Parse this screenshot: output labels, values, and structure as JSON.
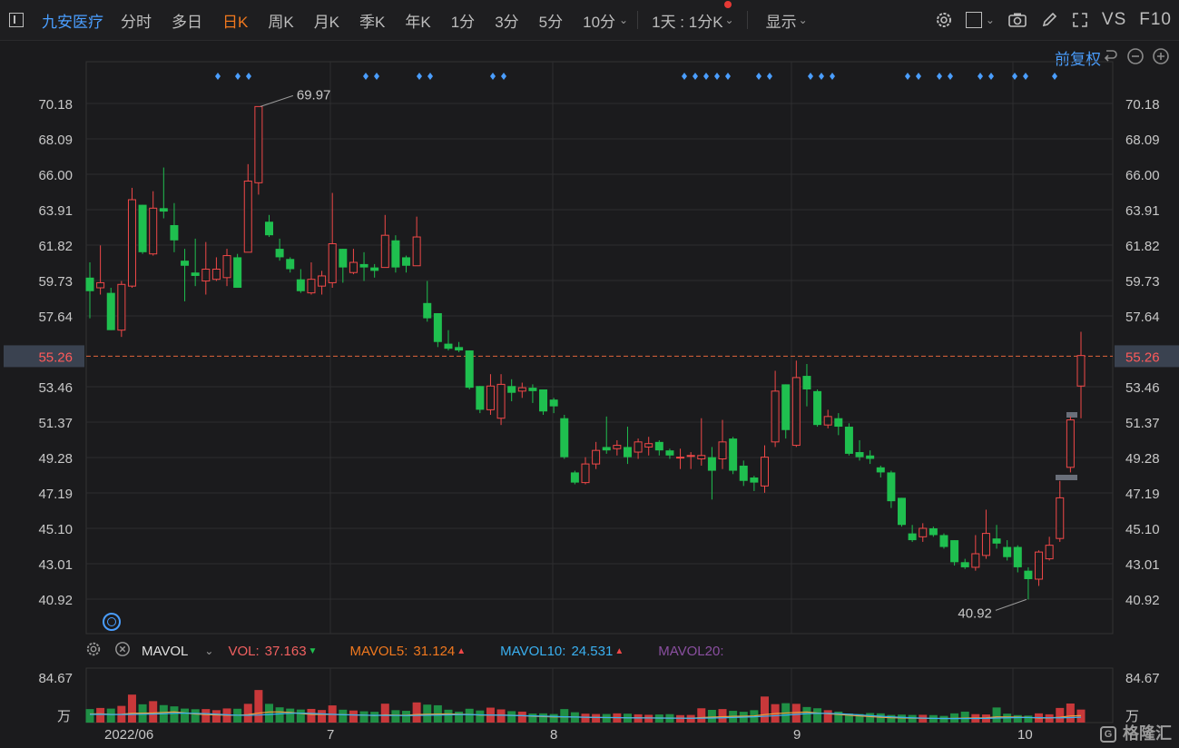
{
  "toolbar": {
    "stock_name": "九安医疗",
    "periods": [
      "分时",
      "多日",
      "日K",
      "周K",
      "月K",
      "季K",
      "年K",
      "1分",
      "3分",
      "5分",
      "10分"
    ],
    "active_period": "日K",
    "interval_label": "1天 : 1分K",
    "display_label": "显示",
    "vs_label": "VS",
    "f10_label": "F10"
  },
  "chart_header": {
    "adjust_label": "前复权"
  },
  "price_axis": {
    "ticks": [
      "70.18",
      "68.09",
      "66.00",
      "63.91",
      "61.82",
      "59.73",
      "57.64",
      "55.26",
      "53.46",
      "51.37",
      "49.28",
      "47.19",
      "45.10",
      "43.01",
      "40.92"
    ],
    "current_price": "55.26"
  },
  "annotations": {
    "high": "69.97",
    "low": "40.92"
  },
  "volume_header": {
    "indicator": "MAVOL",
    "vol_label": "VOL:",
    "vol_value": "37.163",
    "mavol5_label": "MAVOL5:",
    "mavol5_value": "31.124",
    "mavol10_label": "MAVOL10:",
    "mavol10_value": "24.531",
    "mavol20_label": "MAVOL20:"
  },
  "volume_axis": {
    "top": "84.67",
    "unit": "万"
  },
  "date_axis": {
    "labels": [
      "2022/06",
      "7",
      "8",
      "9",
      "10"
    ]
  },
  "brand": "格隆汇",
  "colors": {
    "up": "#f04848",
    "down": "#1fbf4f",
    "accent": "#f0781e",
    "link": "#4a9eff"
  },
  "chart_data": {
    "type": "candlestick",
    "ylim": [
      40.0,
      71.0
    ],
    "candles": [
      {
        "o": 59.9,
        "c": 59.1,
        "h": 60.8,
        "l": 57.5
      },
      {
        "o": 59.3,
        "c": 59.6,
        "h": 61.8,
        "l": 58.9
      },
      {
        "o": 59.0,
        "c": 56.8,
        "h": 59.3,
        "l": 56.8
      },
      {
        "o": 56.8,
        "c": 59.5,
        "h": 59.7,
        "l": 56.4
      },
      {
        "o": 59.4,
        "c": 64.5,
        "h": 65.2,
        "l": 59.3
      },
      {
        "o": 64.2,
        "c": 61.4,
        "h": 64.2,
        "l": 61.3
      },
      {
        "o": 61.3,
        "c": 64.0,
        "h": 65.0,
        "l": 61.2
      },
      {
        "o": 64.0,
        "c": 63.8,
        "h": 66.4,
        "l": 63.4
      },
      {
        "o": 63.0,
        "c": 62.1,
        "h": 64.3,
        "l": 61.4
      },
      {
        "o": 60.9,
        "c": 60.6,
        "h": 61.6,
        "l": 58.5
      },
      {
        "o": 60.2,
        "c": 60.0,
        "h": 62.2,
        "l": 59.4
      },
      {
        "o": 59.7,
        "c": 60.4,
        "h": 62.0,
        "l": 58.9
      },
      {
        "o": 59.8,
        "c": 60.4,
        "h": 61.1,
        "l": 59.7
      },
      {
        "o": 59.9,
        "c": 61.2,
        "h": 61.6,
        "l": 59.4
      },
      {
        "o": 61.1,
        "c": 59.3,
        "h": 61.3,
        "l": 59.3
      },
      {
        "o": 61.4,
        "c": 65.6,
        "h": 66.6,
        "l": 62.3
      },
      {
        "o": 65.5,
        "c": 70.0,
        "h": 70.0,
        "l": 64.8
      },
      {
        "o": 63.2,
        "c": 62.4,
        "h": 63.6,
        "l": 62.3
      },
      {
        "o": 61.6,
        "c": 61.1,
        "h": 62.2,
        "l": 60.9
      },
      {
        "o": 61.0,
        "c": 60.4,
        "h": 61.1,
        "l": 60.2
      },
      {
        "o": 59.8,
        "c": 59.1,
        "h": 60.4,
        "l": 59.0
      },
      {
        "o": 59.0,
        "c": 59.8,
        "h": 60.8,
        "l": 58.9
      },
      {
        "o": 59.4,
        "c": 60.0,
        "h": 60.3,
        "l": 58.9
      },
      {
        "o": 59.6,
        "c": 61.9,
        "h": 64.9,
        "l": 59.3
      },
      {
        "o": 61.6,
        "c": 60.5,
        "h": 61.6,
        "l": 59.6
      },
      {
        "o": 60.2,
        "c": 60.8,
        "h": 61.6,
        "l": 60.1
      },
      {
        "o": 60.7,
        "c": 60.5,
        "h": 61.4,
        "l": 59.7
      },
      {
        "o": 60.5,
        "c": 60.3,
        "h": 60.7,
        "l": 59.9
      },
      {
        "o": 60.5,
        "c": 62.4,
        "h": 63.6,
        "l": 60.5
      },
      {
        "o": 62.1,
        "c": 60.5,
        "h": 62.4,
        "l": 60.2
      },
      {
        "o": 61.1,
        "c": 60.6,
        "h": 61.2,
        "l": 60.2
      },
      {
        "o": 60.6,
        "c": 62.3,
        "h": 63.5,
        "l": 60.6
      },
      {
        "o": 58.4,
        "c": 57.5,
        "h": 59.7,
        "l": 57.3
      },
      {
        "o": 57.8,
        "c": 56.1,
        "h": 57.8,
        "l": 55.8
      },
      {
        "o": 56.0,
        "c": 55.7,
        "h": 56.8,
        "l": 55.6
      },
      {
        "o": 55.8,
        "c": 55.6,
        "h": 56.1,
        "l": 55.5
      },
      {
        "o": 55.6,
        "c": 53.4,
        "h": 55.6,
        "l": 53.3
      },
      {
        "o": 53.5,
        "c": 52.1,
        "h": 53.5,
        "l": 51.9
      },
      {
        "o": 52.1,
        "c": 53.5,
        "h": 54.2,
        "l": 51.8
      },
      {
        "o": 51.6,
        "c": 53.6,
        "h": 54.2,
        "l": 51.2
      },
      {
        "o": 53.5,
        "c": 53.1,
        "h": 53.9,
        "l": 52.6
      },
      {
        "o": 53.2,
        "c": 53.4,
        "h": 53.7,
        "l": 52.8
      },
      {
        "o": 53.4,
        "c": 53.2,
        "h": 53.6,
        "l": 52.5
      },
      {
        "o": 53.3,
        "c": 52.0,
        "h": 53.3,
        "l": 51.8
      },
      {
        "o": 52.7,
        "c": 52.3,
        "h": 52.8,
        "l": 51.9
      },
      {
        "o": 51.6,
        "c": 49.3,
        "h": 51.8,
        "l": 49.2
      },
      {
        "o": 48.4,
        "c": 47.8,
        "h": 48.5,
        "l": 47.7
      },
      {
        "o": 47.8,
        "c": 48.9,
        "h": 49.3,
        "l": 47.7
      },
      {
        "o": 48.9,
        "c": 49.7,
        "h": 50.2,
        "l": 48.6
      },
      {
        "o": 49.9,
        "c": 49.7,
        "h": 51.7,
        "l": 49.5
      },
      {
        "o": 49.8,
        "c": 50.0,
        "h": 50.3,
        "l": 49.4
      },
      {
        "o": 49.9,
        "c": 49.3,
        "h": 51.1,
        "l": 48.9
      },
      {
        "o": 49.6,
        "c": 50.2,
        "h": 50.4,
        "l": 49.2
      },
      {
        "o": 49.9,
        "c": 50.1,
        "h": 50.5,
        "l": 49.4
      },
      {
        "o": 50.2,
        "c": 49.7,
        "h": 50.3,
        "l": 49.4
      },
      {
        "o": 49.7,
        "c": 49.4,
        "h": 49.8,
        "l": 49.2
      },
      {
        "o": 49.3,
        "c": 49.3,
        "h": 49.8,
        "l": 48.6
      },
      {
        "o": 49.4,
        "c": 49.4,
        "h": 49.6,
        "l": 48.6
      },
      {
        "o": 49.2,
        "c": 49.4,
        "h": 51.6,
        "l": 48.8
      },
      {
        "o": 49.3,
        "c": 48.5,
        "h": 49.9,
        "l": 46.8
      },
      {
        "o": 49.2,
        "c": 50.2,
        "h": 51.5,
        "l": 48.6
      },
      {
        "o": 50.4,
        "c": 48.5,
        "h": 50.5,
        "l": 48.3
      },
      {
        "o": 48.8,
        "c": 47.9,
        "h": 49.1,
        "l": 47.6
      },
      {
        "o": 48.1,
        "c": 47.8,
        "h": 48.2,
        "l": 47.3
      },
      {
        "o": 47.6,
        "c": 49.3,
        "h": 50.0,
        "l": 47.2
      },
      {
        "o": 50.2,
        "c": 53.2,
        "h": 54.4,
        "l": 49.9
      },
      {
        "o": 53.6,
        "c": 50.9,
        "h": 53.6,
        "l": 50.4
      },
      {
        "o": 50.0,
        "c": 54.0,
        "h": 55.0,
        "l": 49.9
      },
      {
        "o": 54.1,
        "c": 53.3,
        "h": 54.8,
        "l": 52.3
      },
      {
        "o": 53.2,
        "c": 51.2,
        "h": 53.3,
        "l": 51.1
      },
      {
        "o": 51.2,
        "c": 51.7,
        "h": 52.1,
        "l": 51.0
      },
      {
        "o": 51.6,
        "c": 51.1,
        "h": 51.9,
        "l": 50.6
      },
      {
        "o": 51.1,
        "c": 49.5,
        "h": 51.3,
        "l": 49.4
      },
      {
        "o": 49.6,
        "c": 49.3,
        "h": 50.3,
        "l": 49.1
      },
      {
        "o": 49.4,
        "c": 49.2,
        "h": 49.7,
        "l": 48.9
      },
      {
        "o": 48.7,
        "c": 48.4,
        "h": 48.8,
        "l": 48.1
      },
      {
        "o": 48.4,
        "c": 46.7,
        "h": 48.5,
        "l": 46.3
      },
      {
        "o": 46.9,
        "c": 45.3,
        "h": 46.9,
        "l": 45.2
      },
      {
        "o": 44.8,
        "c": 44.4,
        "h": 45.3,
        "l": 44.3
      },
      {
        "o": 44.6,
        "c": 45.1,
        "h": 45.4,
        "l": 44.3
      },
      {
        "o": 45.1,
        "c": 44.7,
        "h": 45.2,
        "l": 44.6
      },
      {
        "o": 44.7,
        "c": 44.0,
        "h": 44.8,
        "l": 43.9
      },
      {
        "o": 44.4,
        "c": 43.1,
        "h": 44.4,
        "l": 42.9
      },
      {
        "o": 43.1,
        "c": 42.8,
        "h": 43.3,
        "l": 42.7
      },
      {
        "o": 42.8,
        "c": 43.6,
        "h": 44.7,
        "l": 42.6
      },
      {
        "o": 43.5,
        "c": 44.8,
        "h": 46.2,
        "l": 43.3
      },
      {
        "o": 44.5,
        "c": 44.2,
        "h": 45.3,
        "l": 43.9
      },
      {
        "o": 44.0,
        "c": 43.4,
        "h": 44.4,
        "l": 43.2
      },
      {
        "o": 44.0,
        "c": 42.8,
        "h": 44.1,
        "l": 42.5
      },
      {
        "o": 42.6,
        "c": 42.1,
        "h": 42.8,
        "l": 40.9
      },
      {
        "o": 42.1,
        "c": 43.7,
        "h": 43.8,
        "l": 41.7
      },
      {
        "o": 43.3,
        "c": 44.1,
        "h": 44.6,
        "l": 43.2
      },
      {
        "o": 44.5,
        "c": 46.9,
        "h": 47.9,
        "l": 44.3
      },
      {
        "o": 48.7,
        "c": 51.5,
        "h": 51.7,
        "l": 48.4
      },
      {
        "o": 53.5,
        "c": 55.3,
        "h": 56.7,
        "l": 51.6
      }
    ],
    "volumes": [
      8.5,
      9.2,
      8.8,
      10.5,
      17.6,
      11.5,
      13.5,
      11.0,
      10.2,
      8.8,
      8.4,
      8.5,
      7.8,
      8.9,
      8.7,
      11.8,
      20.5,
      11.8,
      9.6,
      8.8,
      8.2,
      8.6,
      7.9,
      10.8,
      8.1,
      7.6,
      7.1,
      6.8,
      11.9,
      7.8,
      7.4,
      12.7,
      11.3,
      10.9,
      8.1,
      6.9,
      8.7,
      7.6,
      9.4,
      8.3,
      7.2,
      6.9,
      5.7,
      5.8,
      5.4,
      8.5,
      6.5,
      5.6,
      5.4,
      5.4,
      5.8,
      5.6,
      5.2,
      4.9,
      5.1,
      5.3,
      4.7,
      4.8,
      9.0,
      8.0,
      8.5,
      7.4,
      6.8,
      7.8,
      16.4,
      11.6,
      12.2,
      11.8,
      9.8,
      9.0,
      7.8,
      6.9,
      5.7,
      5.4,
      6.0,
      5.8,
      4.8,
      5.0,
      4.8,
      4.9,
      4.7,
      4.2,
      5.8,
      6.9,
      5.3,
      5.1,
      9.5,
      5.6,
      4.7,
      4.4,
      5.8,
      5.2,
      9.2,
      12.0,
      8.2
    ],
    "ma5": [
      10.0,
      10.2,
      9.5,
      9.6,
      10.8,
      10.9,
      11.2,
      11.8,
      12.4,
      11.2,
      10.0,
      9.3,
      8.9,
      8.5,
      8.5,
      9.2,
      11.0,
      12.3,
      12.4,
      11.8,
      10.5,
      9.4,
      9.4,
      9.4,
      9.2,
      9.0,
      8.6,
      8.1,
      9.0,
      8.6,
      8.4,
      9.4,
      9.6,
      9.9,
      10.0,
      9.7,
      9.5,
      8.6,
      8.6,
      8.7,
      8.4,
      8.0,
      7.4,
      6.9,
      6.6,
      6.6,
      6.5,
      6.1,
      5.9,
      5.8,
      5.8,
      5.6,
      5.5,
      5.4,
      5.3,
      5.3,
      5.2,
      5.0,
      5.8,
      6.3,
      6.8,
      7.2,
      7.4,
      7.7,
      9.3,
      10.4,
      11.1,
      11.7,
      12.2,
      11.1,
      10.2,
      9.4,
      8.5,
      7.8,
      6.9,
      6.2,
      5.6,
      5.4,
      5.1,
      5.0,
      4.8,
      4.7,
      4.9,
      5.2,
      5.4,
      5.5,
      6.6,
      6.5,
      6.4,
      5.9,
      5.3,
      5.4,
      6.2,
      7.7,
      8.0
    ]
  }
}
